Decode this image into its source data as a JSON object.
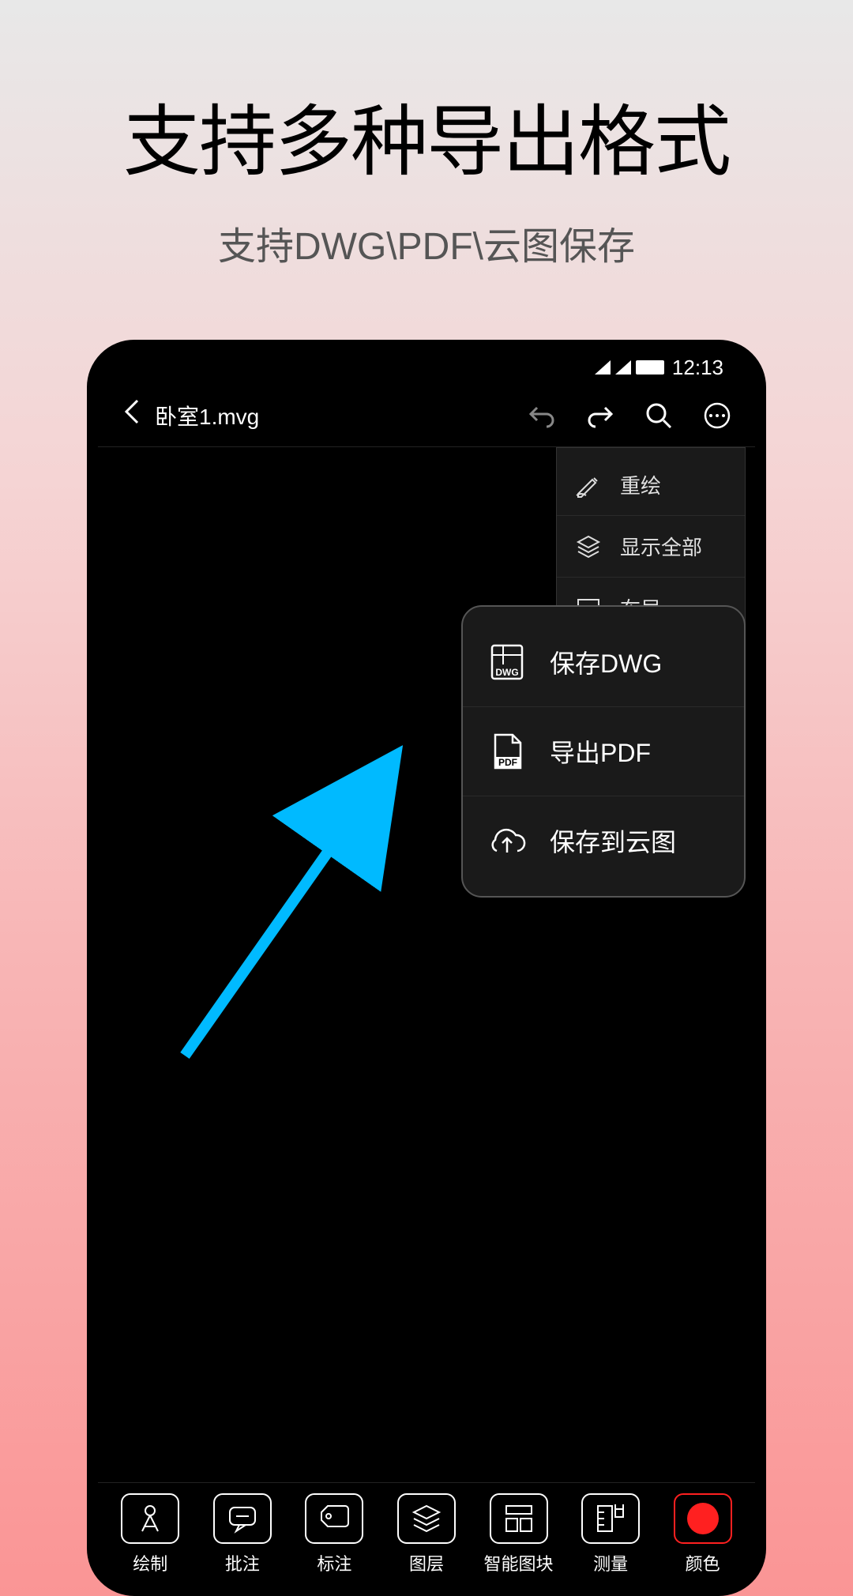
{
  "promo": {
    "title": "支持多种导出格式",
    "subtitle": "支持DWG\\PDF\\云图保存"
  },
  "statusBar": {
    "time": "12:13"
  },
  "header": {
    "fileName": "卧室1.mvg"
  },
  "dropdown": {
    "items": [
      {
        "label": "重绘",
        "icon": "redraw"
      },
      {
        "label": "显示全部",
        "icon": "show-all"
      },
      {
        "label": "布局",
        "icon": "layout"
      }
    ]
  },
  "exportPopover": {
    "items": [
      {
        "label": "保存DWG",
        "icon": "dwg"
      },
      {
        "label": "导出PDF",
        "icon": "pdf"
      },
      {
        "label": "保存到云图",
        "icon": "cloud"
      }
    ]
  },
  "toolbar": {
    "items": [
      {
        "label": "绘制",
        "icon": "draw"
      },
      {
        "label": "批注",
        "icon": "comment"
      },
      {
        "label": "标注",
        "icon": "tag"
      },
      {
        "label": "图层",
        "icon": "layers"
      },
      {
        "label": "智能图块",
        "icon": "blocks"
      },
      {
        "label": "测量",
        "icon": "measure"
      },
      {
        "label": "颜色",
        "icon": "color"
      }
    ]
  }
}
